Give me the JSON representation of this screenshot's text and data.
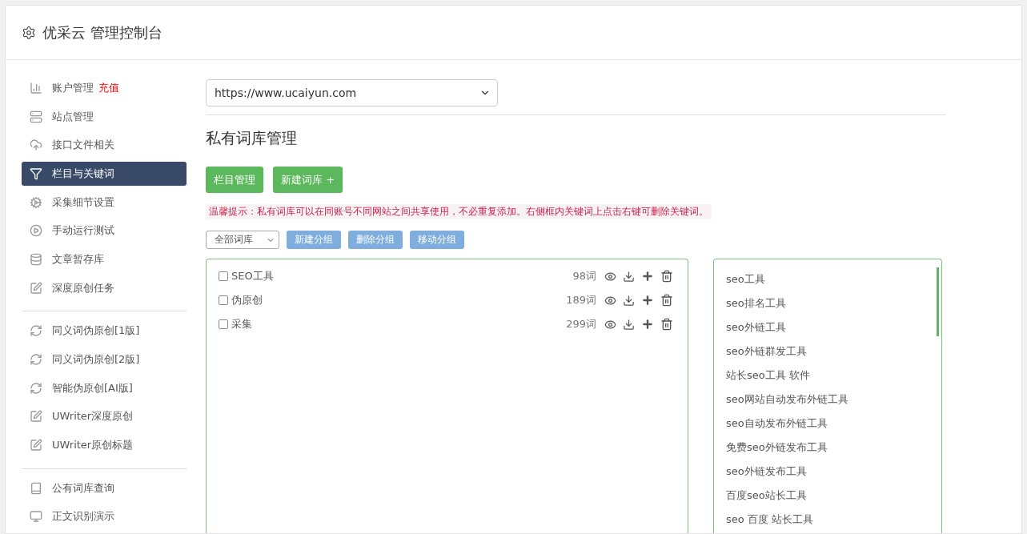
{
  "header": {
    "title": "优采云 管理控制台"
  },
  "sidebar": {
    "groups": [
      {
        "items": [
          {
            "label": "账户管理",
            "badge": "充值",
            "selected": false
          },
          {
            "label": "站点管理",
            "selected": false
          },
          {
            "label": "接口文件相关",
            "selected": false
          },
          {
            "label": "栏目与关键词",
            "selected": true
          },
          {
            "label": "采集细节设置",
            "selected": false
          },
          {
            "label": "手动运行测试",
            "selected": false
          },
          {
            "label": "文章暂存库",
            "selected": false
          },
          {
            "label": "深度原创任务",
            "selected": false
          }
        ]
      },
      {
        "items": [
          {
            "label": "同义词伪原创[1版]",
            "selected": false
          },
          {
            "label": "同义词伪原创[2版]",
            "selected": false
          },
          {
            "label": "智能伪原创[AI版]",
            "selected": false
          },
          {
            "label": "UWriter深度原创",
            "selected": false
          },
          {
            "label": "UWriter原创标题",
            "selected": false
          }
        ]
      },
      {
        "items": [
          {
            "label": "公有词库查询",
            "selected": false
          },
          {
            "label": "正文识别演示",
            "selected": false
          }
        ]
      }
    ]
  },
  "site_select": {
    "value": "https://www.ucaiyun.com"
  },
  "section_title": "私有词库管理",
  "actions": [
    "栏目管理",
    "新建词库 +"
  ],
  "tip": "温馨提示：私有词库可以在同账号不同网站之间共享使用，不必重复添加。右侧框内关键词上点击右键可删除关键词。",
  "group_toolbar": {
    "filter": {
      "value": "全部词库"
    },
    "buttons": [
      "新建分组",
      "删除分组",
      "移动分组"
    ]
  },
  "libraries": [
    {
      "name": "SEO工具",
      "count": "98词",
      "checked": false
    },
    {
      "name": "伪原创",
      "count": "189词",
      "checked": false
    },
    {
      "name": "采集",
      "count": "299词",
      "checked": false
    }
  ],
  "keywords": [
    "seo工具",
    "seo排名工具",
    "seo外链工具",
    "seo外链群发工具",
    "站长seo工具 软件",
    "seo网站自动发布外链工具",
    "seo自动发布外链工具",
    "免费seo外链发布工具",
    "seo外链发布工具",
    "百度seo站长工具",
    "seo 百度 站长工具"
  ]
}
